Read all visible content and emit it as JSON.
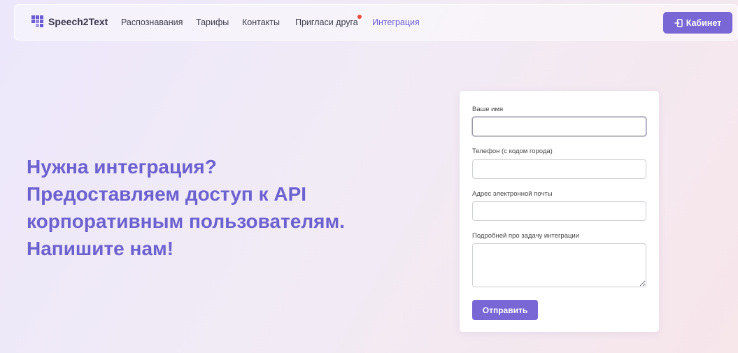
{
  "nav": {
    "brand": "Speech2Text",
    "items": [
      {
        "label": "Распознавания"
      },
      {
        "label": "Тарифы"
      },
      {
        "label": "Контакты"
      },
      {
        "label": "Пригласи друга"
      },
      {
        "label": "Интеграция"
      }
    ],
    "active": "Интеграция",
    "cabinet_label": "Кабинет"
  },
  "hero": {
    "lines": [
      "Нужна интеграция?",
      "Предоставляем доступ к API",
      "корпоративным пользователям.",
      "Напишите нам!"
    ]
  },
  "form": {
    "name_label": "Ваше имя",
    "name_value": "",
    "phone_label": "Телефон (с кодом города)",
    "phone_value": "",
    "email_label": "Адрес электронной почты",
    "email_value": "",
    "details_label": "Подробней про задачу интеграции",
    "details_value": "",
    "submit_label": "Отправить"
  },
  "colors": {
    "accent": "#7867d4",
    "hero_text": "#6d60cf",
    "notification_dot": "#e74c3c"
  }
}
